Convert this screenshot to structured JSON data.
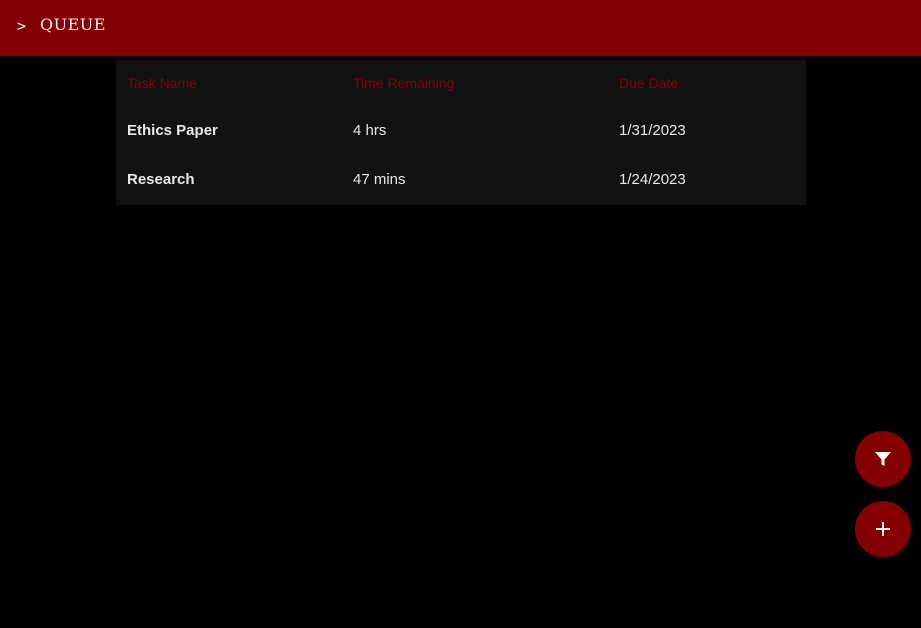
{
  "header": {
    "chevron": ">",
    "title": "QUEUE",
    "background_color": "#850000"
  },
  "table": {
    "columns": [
      "Task Name",
      "Time Remaining",
      "Due Date"
    ],
    "header_color": "#8a0000",
    "rows": [
      {
        "task_name": "Ethics Paper",
        "time_remaining": "4 hrs",
        "due_date": "1/31/2023"
      },
      {
        "task_name": "Research",
        "time_remaining": "47 mins",
        "due_date": "1/24/2023"
      }
    ]
  },
  "actions": {
    "filter_icon": "filter-icon",
    "add_icon": "plus-icon",
    "button_color": "#850000"
  }
}
